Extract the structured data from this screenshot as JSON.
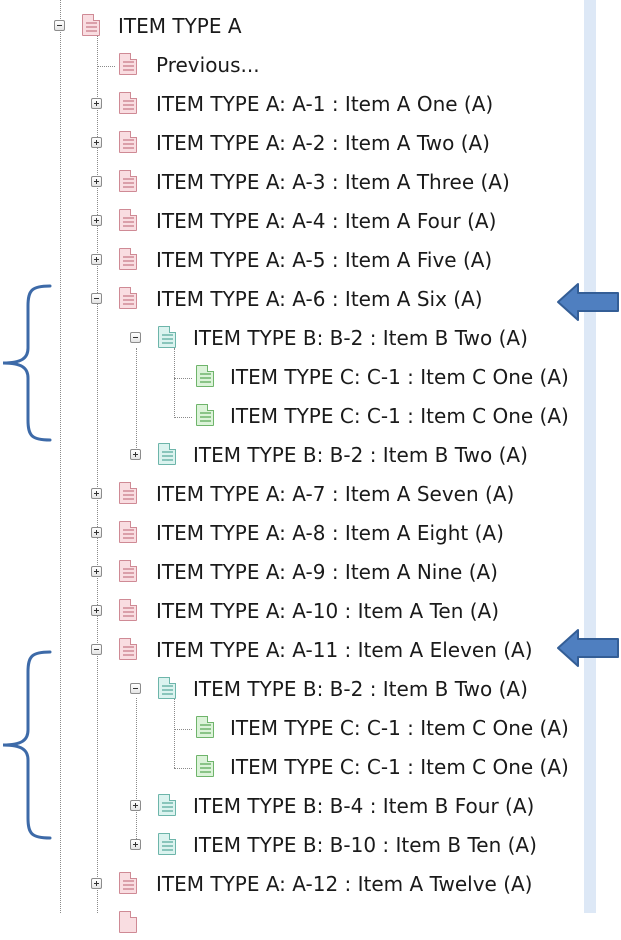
{
  "tree": {
    "root_label": "ITEM TYPE A",
    "previous_label": "Previous...",
    "items": [
      "ITEM TYPE A: A-1 : Item A One (A)",
      "ITEM TYPE A: A-2 : Item A Two (A)",
      "ITEM TYPE A: A-3 : Item A Three (A)",
      "ITEM TYPE A: A-4 : Item A Four (A)",
      "ITEM TYPE A: A-5 : Item A Five (A)",
      "ITEM TYPE A: A-6 : Item A Six (A)",
      "ITEM TYPE B: B-2 : Item B Two (A)",
      "ITEM TYPE C: C-1 : Item C One (A)",
      "ITEM TYPE C: C-1 : Item C One (A)",
      "ITEM TYPE B: B-2 : Item B Two (A)",
      "ITEM TYPE A: A-7 : Item A Seven (A)",
      "ITEM TYPE A: A-8 : Item A Eight (A)",
      "ITEM TYPE A: A-9 : Item A Nine (A)",
      "ITEM TYPE A: A-10 : Item A Ten (A)",
      "ITEM TYPE A: A-11 : Item A Eleven (A)",
      "ITEM TYPE B: B-2 : Item B Two (A)",
      "ITEM TYPE C: C-1 : Item C One (A)",
      "ITEM TYPE C: C-1 : Item C One (A)",
      "ITEM TYPE B: B-4 : Item B Four (A)",
      "ITEM TYPE B: B-10 : Item B Ten (A)",
      "ITEM TYPE A: A-12 : Item A Twelve (A)"
    ]
  },
  "colors": {
    "type_a_icon": "#f9dde1",
    "type_b_icon": "#dbf3ef",
    "type_c_icon": "#dcf3d9",
    "annotation": "#3d6aa8",
    "scrollbar": "#dde8f6"
  },
  "icons": {
    "type_a": "document-pink-icon",
    "type_b": "document-teal-icon",
    "type_c": "document-green-icon",
    "annotation_arrow": "left-arrow-icon",
    "annotation_brace": "curly-brace-icon"
  }
}
